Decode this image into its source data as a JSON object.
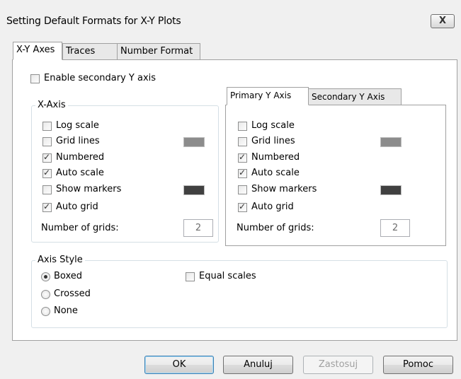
{
  "window": {
    "title": "Setting Default Formats for X-Y Plots",
    "close_label": "X"
  },
  "tabs": [
    {
      "label": "X-Y Axes"
    },
    {
      "label": "Traces"
    },
    {
      "label": "Number Format"
    }
  ],
  "secondary_y": {
    "label": "Enable secondary Y axis",
    "checked": false
  },
  "x_axis": {
    "title": "X-Axis",
    "log_scale": "Log scale",
    "grid_lines": "Grid lines",
    "numbered": "Numbered",
    "auto_scale": "Auto scale",
    "show_markers": "Show markers",
    "auto_grid": "Auto grid",
    "grids_label": "Number of grids:",
    "grids_value": "2",
    "grid_color": "#8c8c8c",
    "marker_color": "#404040"
  },
  "y_tabs": [
    {
      "label": "Primary Y Axis"
    },
    {
      "label": "Secondary Y Axis"
    }
  ],
  "y_axis": {
    "log_scale": "Log scale",
    "grid_lines": "Grid lines",
    "numbered": "Numbered",
    "auto_scale": "Auto scale",
    "show_markers": "Show markers",
    "auto_grid": "Auto grid",
    "grids_label": "Number of grids:",
    "grids_value": "2",
    "grid_color": "#8c8c8c",
    "marker_color": "#404040"
  },
  "axis_style": {
    "title": "Axis Style",
    "boxed": "Boxed",
    "crossed": "Crossed",
    "none": "None",
    "equal_scales": "Equal scales",
    "selected": "Boxed"
  },
  "buttons": {
    "ok": "OK",
    "cancel": "Anuluj",
    "apply": "Zastosuj",
    "help": "Pomoc"
  }
}
